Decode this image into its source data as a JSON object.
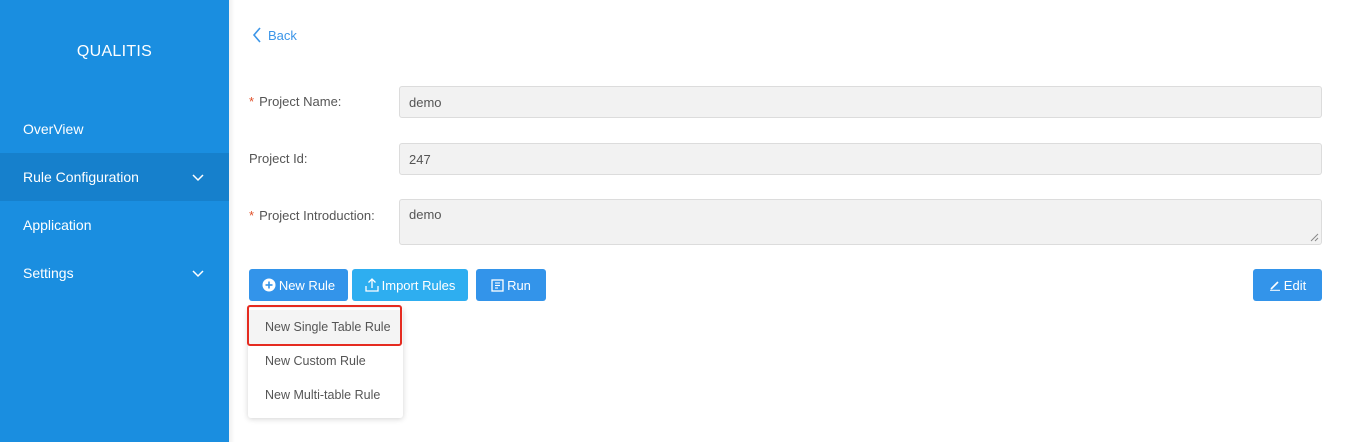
{
  "sidebar": {
    "brand": "QUALITIS",
    "items": [
      {
        "label": "OverView"
      },
      {
        "label": "Rule Configuration"
      },
      {
        "label": "Application"
      },
      {
        "label": "Settings"
      }
    ]
  },
  "header": {
    "back_label": "Back"
  },
  "form": {
    "project_name": {
      "label": "Project Name:",
      "value": "demo",
      "required": "*"
    },
    "project_id": {
      "label": "Project Id:",
      "value": "247"
    },
    "project_intro": {
      "label": "Project Introduction:",
      "value": "demo",
      "required": "*"
    }
  },
  "toolbar": {
    "new_rule_label": "New Rule",
    "import_rules_label": "Import Rules",
    "run_label": "Run",
    "edit_label": "Edit"
  },
  "dropdown": {
    "items": [
      {
        "label": "New Single Table Rule"
      },
      {
        "label": "New Custom Rule"
      },
      {
        "label": "New Multi-table Rule"
      }
    ]
  },
  "colors": {
    "sidebar_bg": "#1a8ee0",
    "primary": "#3394ea",
    "highlight_border": "#e52b20"
  }
}
